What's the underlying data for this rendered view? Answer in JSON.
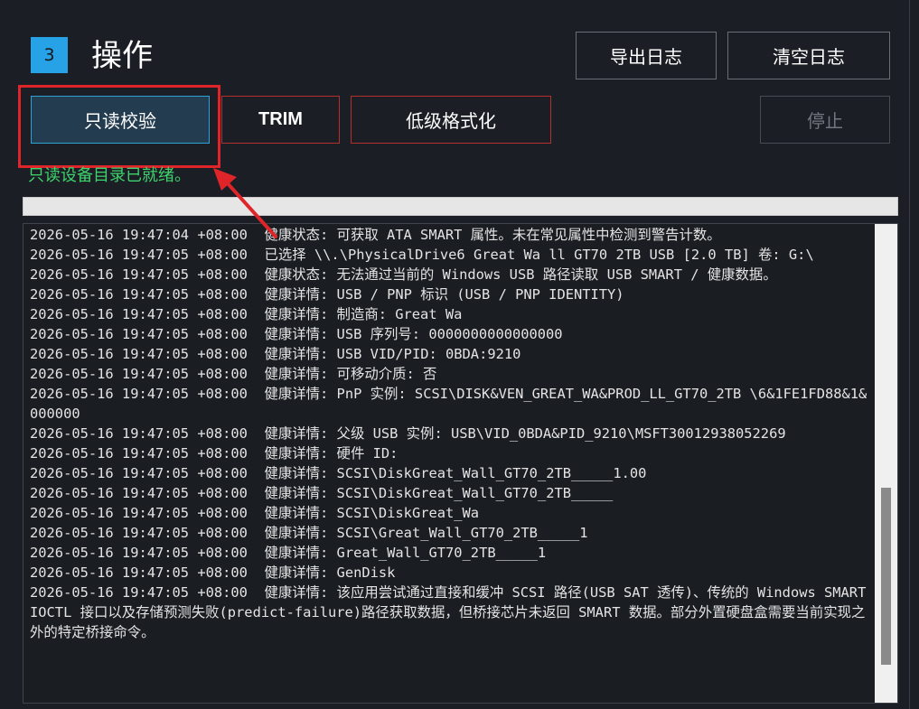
{
  "section": {
    "step_number": "3",
    "title": "操作"
  },
  "toolbar": {
    "export_label": "导出日志",
    "clear_label": "清空日志",
    "readonly_label": "只读校验",
    "trim_label": "TRIM",
    "format_label": "低级格式化",
    "stop_label": "停止"
  },
  "status": {
    "message": "只读设备目录已就绪。"
  },
  "progress": {
    "value_percent": 0
  },
  "log": {
    "scroll_position": 0.93,
    "entries": [
      {
        "ts": "2026-05-16 19:47:04 +08:00",
        "msg": "健康状态: 可获取 ATA SMART 属性。未在常见属性中检测到警告计数。"
      },
      {
        "ts": "2026-05-16 19:47:05 +08:00",
        "msg": "已选择 \\\\.\\PhysicalDrive6 Great Wa ll GT70 2TB USB [2.0 TB] 卷: G:\\"
      },
      {
        "ts": "2026-05-16 19:47:05 +08:00",
        "msg": "健康状态: 无法通过当前的 Windows USB 路径读取 USB SMART / 健康数据。"
      },
      {
        "ts": "2026-05-16 19:47:05 +08:00",
        "msg": "健康详情: USB / PNP 标识 (USB / PNP IDENTITY)"
      },
      {
        "ts": "2026-05-16 19:47:05 +08:00",
        "msg": "健康详情: 制造商: Great Wa"
      },
      {
        "ts": "2026-05-16 19:47:05 +08:00",
        "msg": "健康详情: USB 序列号: 0000000000000000"
      },
      {
        "ts": "2026-05-16 19:47:05 +08:00",
        "msg": "健康详情: USB VID/PID: 0BDA:9210"
      },
      {
        "ts": "2026-05-16 19:47:05 +08:00",
        "msg": "健康详情: 可移动介质: 否"
      },
      {
        "ts": "2026-05-16 19:47:05 +08:00",
        "msg": "健康详情: PnP 实例: SCSI\\DISK&VEN_GREAT_WA&PROD_LL_GT70_2TB \\6&1FE1FD88&1&000000"
      },
      {
        "ts": "2026-05-16 19:47:05 +08:00",
        "msg": "健康详情: 父级 USB 实例: USB\\VID_0BDA&PID_9210\\MSFT30012938052269"
      },
      {
        "ts": "2026-05-16 19:47:05 +08:00",
        "msg": "健康详情: 硬件 ID:"
      },
      {
        "ts": "2026-05-16 19:47:05 +08:00",
        "msg": "健康详情: SCSI\\DiskGreat_Wall_GT70_2TB_____1.00"
      },
      {
        "ts": "2026-05-16 19:47:05 +08:00",
        "msg": "健康详情: SCSI\\DiskGreat_Wall_GT70_2TB_____"
      },
      {
        "ts": "2026-05-16 19:47:05 +08:00",
        "msg": "健康详情: SCSI\\DiskGreat_Wa"
      },
      {
        "ts": "2026-05-16 19:47:05 +08:00",
        "msg": "健康详情: SCSI\\Great_Wall_GT70_2TB_____1"
      },
      {
        "ts": "2026-05-16 19:47:05 +08:00",
        "msg": "健康详情: Great_Wall_GT70_2TB_____1"
      },
      {
        "ts": "2026-05-16 19:47:05 +08:00",
        "msg": "健康详情: GenDisk"
      },
      {
        "ts": "2026-05-16 19:47:05 +08:00",
        "msg": "健康详情: 该应用尝试通过直接和缓冲 SCSI 路径(USB SAT 透传)、传统的 Windows SMART IOCTL 接口以及存储预测失败(predict-failure)路径获取数据，但桥接芯片未返回 SMART 数据。部分外置硬盘盒需要当前实现之外的特定桥接命令。"
      }
    ]
  },
  "colors": {
    "accent": "#27a2e6",
    "status_green": "#3fd36d",
    "danger_border": "#b3312c",
    "annotation_red": "#e0252a"
  }
}
